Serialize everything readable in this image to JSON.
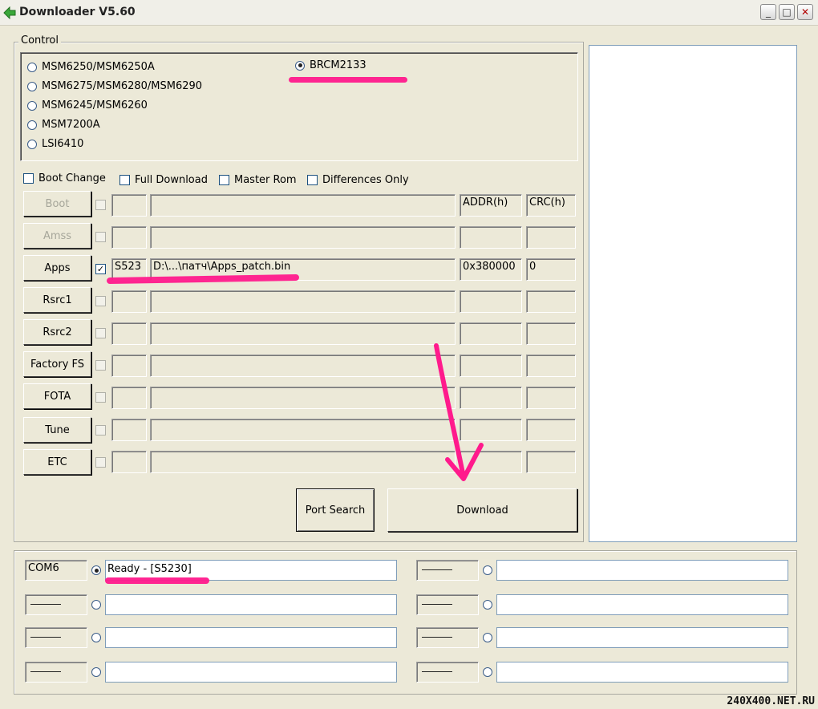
{
  "window": {
    "title": "Downloader V5.60",
    "controls": [
      "minimize",
      "maximize",
      "close"
    ]
  },
  "control_group": {
    "legend": "Control",
    "chips": [
      {
        "label": "MSM6250/MSM6250A",
        "selected": false
      },
      {
        "label": "MSM6275/MSM6280/MSM6290",
        "selected": false
      },
      {
        "label": "MSM6245/MSM6260",
        "selected": false
      },
      {
        "label": "MSM7200A",
        "selected": false
      },
      {
        "label": "LSI6410",
        "selected": false
      },
      {
        "label": "BRCM2133",
        "selected": true
      }
    ]
  },
  "options": {
    "boot_change": "Boot Change",
    "full_download": "Full Download",
    "master_rom": "Master Rom",
    "differences_only": "Differences Only"
  },
  "table": {
    "addr_header": "ADDR(h)",
    "crc_header": "CRC(h)",
    "rows": [
      {
        "button": "Boot",
        "enabled": false,
        "checked": false,
        "model": "",
        "path": "",
        "addr": "",
        "crc": ""
      },
      {
        "button": "Amss",
        "enabled": false,
        "checked": false,
        "model": "",
        "path": "",
        "addr": "",
        "crc": ""
      },
      {
        "button": "Apps",
        "enabled": true,
        "checked": true,
        "model": "S523",
        "path": "D:\\...\\патч\\Apps_patch.bin",
        "addr": "0x380000",
        "crc": "0"
      },
      {
        "button": "Rsrc1",
        "enabled": true,
        "checked": false,
        "model": "",
        "path": "",
        "addr": "",
        "crc": ""
      },
      {
        "button": "Rsrc2",
        "enabled": true,
        "checked": false,
        "model": "",
        "path": "",
        "addr": "",
        "crc": ""
      },
      {
        "button": "Factory FS",
        "enabled": true,
        "checked": false,
        "model": "",
        "path": "",
        "addr": "",
        "crc": ""
      },
      {
        "button": "FOTA",
        "enabled": true,
        "checked": false,
        "model": "",
        "path": "",
        "addr": "",
        "crc": ""
      },
      {
        "button": "Tune",
        "enabled": true,
        "checked": false,
        "model": "",
        "path": "",
        "addr": "",
        "crc": ""
      },
      {
        "button": "ETC",
        "enabled": true,
        "checked": false,
        "model": "",
        "path": "",
        "addr": "",
        "crc": ""
      }
    ]
  },
  "actions": {
    "port_search": "Port Search",
    "download": "Download"
  },
  "ports": {
    "left": [
      {
        "name": "COM6",
        "status": "Ready - [S5230]",
        "selected": true
      },
      {
        "name": "———",
        "status": "",
        "selected": false
      },
      {
        "name": "———",
        "status": "",
        "selected": false
      },
      {
        "name": "———",
        "status": "",
        "selected": false
      }
    ],
    "right": [
      {
        "name": "———",
        "status": "",
        "selected": false
      },
      {
        "name": "———",
        "status": "",
        "selected": false
      },
      {
        "name": "———",
        "status": "",
        "selected": false
      },
      {
        "name": "———",
        "status": "",
        "selected": false
      }
    ]
  },
  "watermark": "240X400.NET.RU",
  "colors": {
    "window_bg": "#ece9d8",
    "highlight": "#ff1a8c",
    "title_icon": "#3aa83a"
  }
}
